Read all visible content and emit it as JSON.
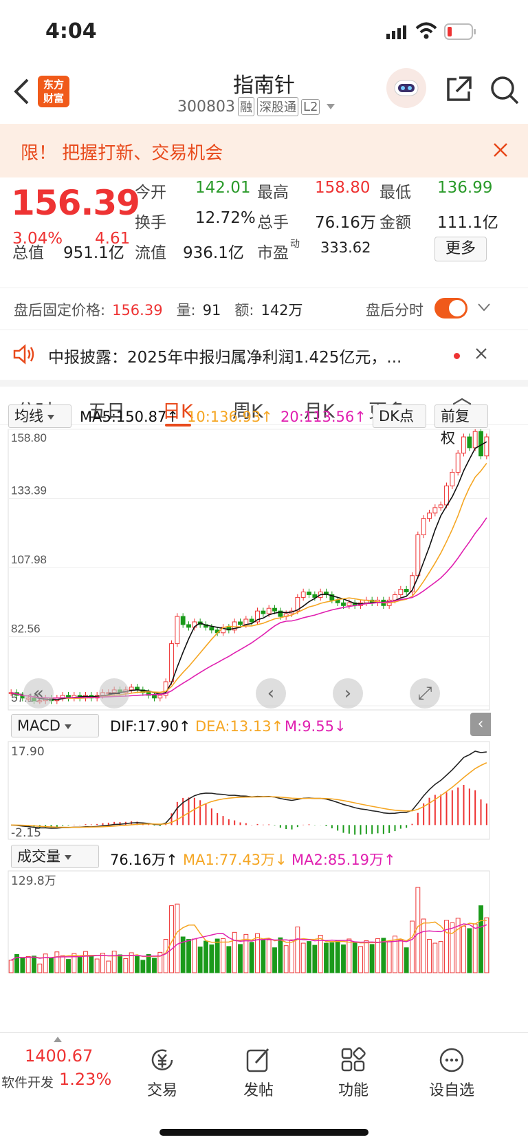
{
  "status_bar": {
    "time": "4:04"
  },
  "nav": {
    "logo_line1": "东方",
    "logo_line2": "财富",
    "title": "指南针",
    "code": "300803",
    "badges": [
      "融",
      "深股通",
      "L2"
    ]
  },
  "banner": {
    "text": "限！ 把握打新、交易机会"
  },
  "quote": {
    "price": "156.39",
    "change_pct": "3.04%",
    "change": "4.61",
    "fields": [
      {
        "label": "今开",
        "value": "142.01",
        "color": "#2a9a2a"
      },
      {
        "label": "最高",
        "value": "158.80",
        "color": "#e33"
      },
      {
        "label": "最低",
        "value": "136.99",
        "color": "#2a9a2a"
      },
      {
        "label": "换手",
        "value": "12.72%",
        "color": "#222"
      },
      {
        "label": "总手",
        "value": "76.16万",
        "color": "#222"
      },
      {
        "label": "金额",
        "value": "111.1亿",
        "color": "#222"
      },
      {
        "label": "总值",
        "value": "951.1亿",
        "color": "#222"
      },
      {
        "label": "流值",
        "value": "936.1亿",
        "color": "#222"
      },
      {
        "label": "市盈",
        "value": "333.62",
        "color": "#222"
      }
    ],
    "pe_sup": "动",
    "more_label": "更多"
  },
  "afterhours": {
    "label": "盘后固定价格:",
    "price": "156.39",
    "vol_label": "量:",
    "vol": "91",
    "amt_label": "额:",
    "amt": "142万",
    "toggle_label": "盘后分时"
  },
  "notice": {
    "text": "中报披露：2025年中报归属净利润1.425亿元，..."
  },
  "tabs": [
    {
      "label": "分时",
      "active": false
    },
    {
      "label": "五日",
      "active": false
    },
    {
      "label": "日K",
      "active": true
    },
    {
      "label": "周K",
      "active": false
    },
    {
      "label": "月K",
      "active": false
    },
    {
      "label": "更多",
      "active": false
    }
  ],
  "indicators": {
    "ma_selector": "均线",
    "ma5": "MA5:150.87↑",
    "ma10": "10:136.93↑",
    "ma20": "20:113.56↑",
    "dk_label": "DK点",
    "fq_label": "前复权",
    "macd_selector": "MACD",
    "dif": "DIF:17.90↑",
    "dea": "DEA:13.13↑",
    "m": "M:9.55↓",
    "vol_selector": "成交量",
    "vol_now": "76.16万↑",
    "vol_ma1": "MA1:77.43万↓",
    "vol_ma2": "MA2:85.19万↑"
  },
  "colors": {
    "up": "#e33",
    "down": "#1a9a1a",
    "ma5": "#111",
    "ma10": "#f5a623",
    "ma20": "#e020b0",
    "accent": "#e84a1c"
  },
  "chart_data": [
    {
      "type": "candlestick",
      "ylim": [
        57.15,
        158.8
      ],
      "y_ticks": [
        "158.80",
        "133.39",
        "107.98",
        "82.56",
        "57.15"
      ],
      "closes": [
        62,
        61,
        60,
        60,
        59,
        59,
        60,
        59,
        60,
        61,
        60,
        61,
        60,
        61,
        60,
        61,
        62,
        62,
        63,
        62,
        63,
        64,
        63,
        62,
        61,
        60,
        61,
        66,
        80,
        90,
        87,
        86,
        88,
        87,
        86,
        85,
        84,
        86,
        85,
        88,
        87,
        89,
        88,
        92,
        91,
        93,
        92,
        90,
        91,
        92,
        97,
        99,
        98,
        97,
        99,
        98,
        96,
        95,
        94,
        95,
        94,
        95,
        96,
        95,
        96,
        94,
        96,
        98,
        100,
        99,
        105,
        120,
        126,
        128,
        130,
        131,
        138,
        143,
        150,
        156,
        152,
        158,
        149,
        156
      ]
    },
    {
      "type": "line",
      "name": "MACD",
      "y_ticks": [
        "17.90",
        "-2.15"
      ]
    },
    {
      "type": "bar",
      "name": "成交量",
      "y_ticks": [
        "129.8万"
      ]
    }
  ],
  "bottom": {
    "index_value": "1400.67",
    "index_name": "软件开发",
    "index_pct": "1.23%",
    "items": [
      "交易",
      "发帖",
      "功能",
      "设自选"
    ]
  }
}
